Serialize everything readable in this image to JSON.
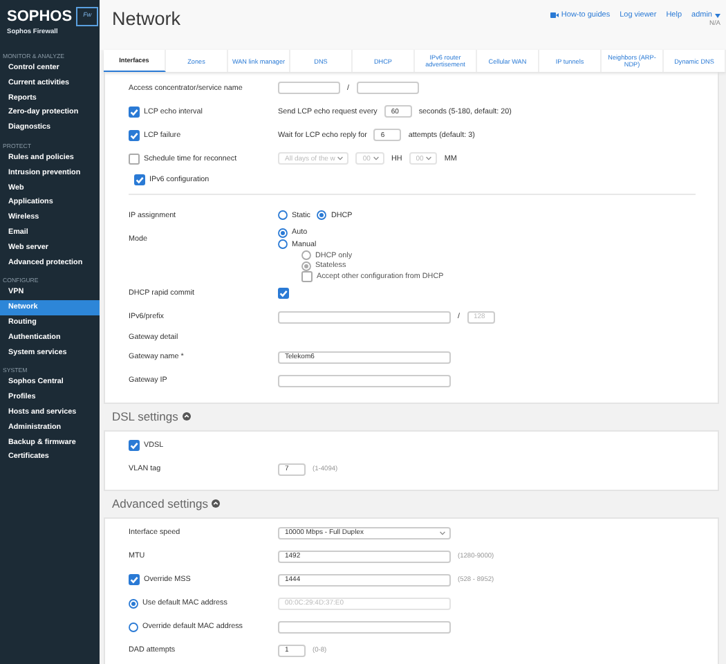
{
  "sidebar": {
    "logo": "SOPHOS",
    "badge": "Fw",
    "product": "Sophos Firewall",
    "sections": [
      {
        "title": "MONITOR & ANALYZE",
        "items": [
          {
            "label": "Control center",
            "selected": false
          },
          {
            "label": "Current activities",
            "selected": false
          },
          {
            "label": "Reports",
            "selected": false
          },
          {
            "label": "Zero-day protection",
            "selected": false
          },
          {
            "label": "Diagnostics",
            "selected": false
          }
        ]
      },
      {
        "title": "PROTECT",
        "items": [
          {
            "label": "Rules and policies",
            "selected": false
          },
          {
            "label": "Intrusion prevention",
            "selected": false
          },
          {
            "label": "Web",
            "selected": false
          },
          {
            "label": "Applications",
            "selected": false
          },
          {
            "label": "Wireless",
            "selected": false
          },
          {
            "label": "Email",
            "selected": false
          },
          {
            "label": "Web server",
            "selected": false
          },
          {
            "label": "Advanced protection",
            "selected": false
          }
        ]
      },
      {
        "title": "CONFIGURE",
        "items": [
          {
            "label": "VPN",
            "selected": false
          },
          {
            "label": "Network",
            "selected": true
          },
          {
            "label": "Routing",
            "selected": false
          },
          {
            "label": "Authentication",
            "selected": false
          },
          {
            "label": "System services",
            "selected": false
          }
        ]
      },
      {
        "title": "SYSTEM",
        "items": [
          {
            "label": "Sophos Central",
            "selected": false
          },
          {
            "label": "Profiles",
            "selected": false
          },
          {
            "label": "Hosts and services",
            "selected": false
          },
          {
            "label": "Administration",
            "selected": false
          },
          {
            "label": "Backup & firmware",
            "selected": false
          },
          {
            "label": "Certificates",
            "selected": false
          }
        ]
      }
    ]
  },
  "header": {
    "title": "Network",
    "links": [
      {
        "label": "How-to guides",
        "kind": "guide"
      },
      {
        "label": "Log viewer",
        "kind": "plain"
      },
      {
        "label": "Help",
        "kind": "plain"
      }
    ],
    "user": {
      "name": "admin",
      "detail": "N/A"
    }
  },
  "tabs": [
    {
      "label": "Interfaces",
      "selected": true
    },
    {
      "label": "Zones",
      "selected": false
    },
    {
      "label": "WAN link manager",
      "selected": false
    },
    {
      "label": "DNS",
      "selected": false
    },
    {
      "label": "DHCP",
      "selected": false
    },
    {
      "label": "IPv6 router advertisement",
      "selected": false
    },
    {
      "label": "Cellular WAN",
      "selected": false
    },
    {
      "label": "IP tunnels",
      "selected": false
    },
    {
      "label": "Neighbors (ARP-NDP)",
      "selected": false
    },
    {
      "label": "Dynamic DNS",
      "selected": false
    }
  ],
  "panels": [
    {
      "rows": [
        {
          "kind": "field",
          "label": "Access concentrator/service name",
          "controls": [
            {
              "kind": "small-input"
            },
            {
              "kind": "text",
              "text": "/"
            },
            {
              "kind": "small-input"
            }
          ]
        },
        {
          "kind": "check-field",
          "label": "LCP echo interval",
          "checked": true,
          "controls": [
            {
              "kind": "text",
              "text": "Send LCP echo request every"
            },
            {
              "kind": "number-input",
              "value": "60"
            },
            {
              "kind": "text",
              "text": "seconds (5-180, default: 20)"
            }
          ]
        },
        {
          "kind": "check-field",
          "label": "LCP failure",
          "checked": true,
          "controls": [
            {
              "kind": "text",
              "text": "Wait for LCP echo reply for"
            },
            {
              "kind": "number-input",
              "value": "6"
            },
            {
              "kind": "text",
              "text": "attempts (default: 3)"
            }
          ]
        },
        {
          "kind": "check-field",
          "label": "Schedule time for reconnect",
          "checked": false,
          "controls": [
            {
              "kind": "small-select",
              "value": "All days of the w",
              "disabled": true
            },
            {
              "kind": "tiny-select",
              "value": "00",
              "disabled": true
            },
            {
              "kind": "text",
              "text": "HH"
            },
            {
              "kind": "tiny-select",
              "value": "00",
              "disabled": true
            },
            {
              "kind": "text",
              "text": "MM"
            }
          ]
        },
        {
          "kind": "toggle",
          "label": "IPv6 configuration",
          "checked": true
        },
        {
          "kind": "divider"
        },
        {
          "kind": "field",
          "label": "IP assignment",
          "controls": [
            {
              "kind": "radio",
              "label": "Static",
              "selected": false
            },
            {
              "kind": "radio",
              "label": "DHCP",
              "selected": true
            }
          ]
        },
        {
          "kind": "field",
          "label": "Mode",
          "controls": [
            {
              "kind": "radio-list",
              "options": [
                {
                  "kind": "radio",
                  "label": "Auto",
                  "selected": true
                },
                {
                  "kind": "radio",
                  "label": "Manual",
                  "selected": false
                }
              ]
            }
          ]
        },
        {
          "kind": "field",
          "controls": [
            {
              "kind": "option-list",
              "options": [
                {
                  "kind": "radio",
                  "label": "DHCP only",
                  "selected": false,
                  "disabled": true
                },
                {
                  "kind": "radio",
                  "label": "Stateless",
                  "selected": true,
                  "disabled": true
                },
                {
                  "kind": "checkbox",
                  "label": "Accept other configuration from DHCP",
                  "checked": false,
                  "disabled": true
                }
              ]
            }
          ]
        },
        {
          "kind": "field",
          "label": "DHCP rapid commit",
          "controls": [
            {
              "kind": "checkbox",
              "checked": true
            }
          ]
        },
        {
          "kind": "field",
          "label": "IPv6/prefix",
          "controls": [
            {
              "kind": "input"
            },
            {
              "kind": "text",
              "text": "/"
            },
            {
              "kind": "number-input",
              "placeholder": "128"
            }
          ]
        },
        {
          "kind": "subheading",
          "label": "Gateway detail"
        },
        {
          "kind": "field",
          "label": "Gateway name *",
          "controls": [
            {
              "kind": "input",
              "value": "Telekom6"
            }
          ]
        },
        {
          "kind": "field",
          "label": "Gateway IP",
          "controls": [
            {
              "kind": "input"
            }
          ]
        }
      ]
    },
    {
      "title": "DSL settings",
      "rows": [
        {
          "kind": "check-field",
          "label": "VDSL",
          "checked": true
        },
        {
          "kind": "field",
          "label": "VLAN tag",
          "controls": [
            {
              "kind": "number-input",
              "value": "7"
            },
            {
              "kind": "hint",
              "text": "(1-4094)"
            }
          ]
        }
      ]
    },
    {
      "title": "Advanced settings",
      "rows": [
        {
          "kind": "field",
          "label": "Interface speed",
          "controls": [
            {
              "kind": "select",
              "value": "10000 Mbps - Full Duplex"
            }
          ]
        },
        {
          "kind": "field",
          "label": "MTU",
          "controls": [
            {
              "kind": "input",
              "value": "1492"
            },
            {
              "kind": "hint",
              "text": "(1280-9000)"
            }
          ]
        },
        {
          "kind": "check-field",
          "label": "Override MSS",
          "checked": true,
          "controls": [
            {
              "kind": "input",
              "value": "1444"
            },
            {
              "kind": "hint",
              "text": "(528 - 8952)"
            }
          ]
        },
        {
          "kind": "radio-field",
          "label": "Use default MAC address",
          "selected": true,
          "controls": [
            {
              "kind": "input",
              "placeholder": "00:0C:29:4D:37:E0",
              "disabled": true
            }
          ]
        },
        {
          "kind": "radio-field",
          "label": "Override default MAC address",
          "selected": false,
          "controls": [
            {
              "kind": "input"
            }
          ]
        },
        {
          "kind": "field",
          "label": "DAD attempts",
          "controls": [
            {
              "kind": "number-input",
              "value": "1"
            },
            {
              "kind": "hint",
              "text": "(0-8)"
            }
          ]
        }
      ]
    }
  ]
}
